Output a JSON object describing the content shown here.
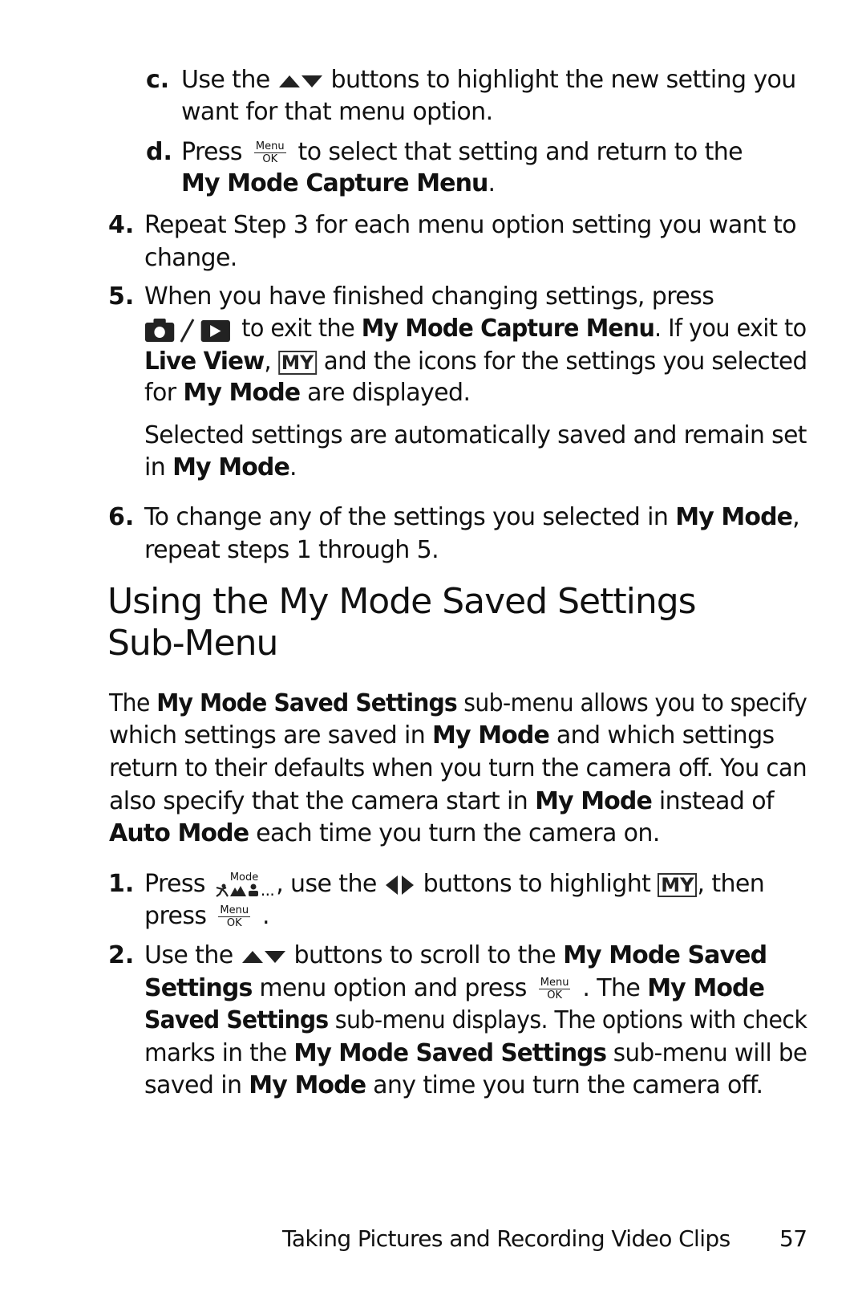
{
  "items_top": {
    "c": {
      "marker": "c.",
      "line1_a": "Use the",
      "line1_b": "buttons to highlight the new setting you",
      "line2": "want for that menu option."
    },
    "d": {
      "marker": "d.",
      "line1_a": "Press",
      "line1_b": "to select that setting and return to the",
      "line2_bold": "My Mode Capture Menu",
      "line2_end": "."
    },
    "step4": {
      "marker": "4.",
      "line1": "Repeat Step 3 for each menu option setting you want to",
      "line2": "change."
    },
    "step5": {
      "marker": "5.",
      "line1": "When you have finished changing settings, press",
      "line2_a": "to exit the",
      "line2_bold": "My Mode Capture Menu",
      "line2_b": ". If you exit to",
      "line3_bold": "Live View",
      "line3_a": ",",
      "line3_b": "and the icons for the settings you selected",
      "line4_a": "for",
      "line4_bold": "My Mode",
      "line4_b": "are displayed.",
      "note1": "Selected settings are automatically saved and remain set",
      "note2_a": "in",
      "note2_bold": "My Mode",
      "note2_b": "."
    },
    "step6": {
      "marker": "6.",
      "line1_a": "To change any of the settings you selected in",
      "line1_bold": "My Mode",
      "line1_b": ",",
      "line2": "repeat steps 1 through 5."
    }
  },
  "section": {
    "heading_line1": "Using the My Mode Saved Settings",
    "heading_line2": "Sub-Menu",
    "intro": {
      "l1_a": "The",
      "l1_bold": "My Mode Saved Settings",
      "l1_b": "sub-menu allows you to specify",
      "l2_a": "which settings are saved in",
      "l2_bold": "My Mode",
      "l2_b": "and which settings",
      "l3": "return to their defaults when you turn the camera off. You can",
      "l4_a": "also specify that the camera start in",
      "l4_bold": "My Mode",
      "l4_b": "instead of",
      "l5_bold": "Auto Mode",
      "l5_b": "each time you turn the camera on."
    },
    "step1": {
      "marker": "1.",
      "l1_a": "Press",
      "l1_b": ", use the",
      "l1_c": "buttons to highlight",
      "l1_d": ", then",
      "l2_a": "press",
      "l2_b": "."
    },
    "step2": {
      "marker": "2.",
      "l1_a": "Use the",
      "l1_b": "buttons to scroll to the",
      "l1_bold": "My Mode Saved",
      "l2_bold": "Settings",
      "l2_a": "menu option and press",
      "l2_b": ". The",
      "l2_bold2": "My Mode",
      "l3_bold": "Saved Settings",
      "l3_a": "sub-menu displays. The options with check",
      "l4_a": "marks in the",
      "l4_bold": "My Mode Saved Settings",
      "l4_b": "sub-menu will be",
      "l5_a": "saved in",
      "l5_bold": "My Mode",
      "l5_b": "any time you turn the camera off."
    }
  },
  "icons": {
    "menu_ok_top": "Menu",
    "menu_ok_bottom": "OK",
    "my_label": "MY",
    "mode_label": "Mode",
    "mode_ellipsis": "..."
  },
  "footer": {
    "chapter": "Taking Pictures and Recording Video Clips",
    "page_number": "57"
  }
}
